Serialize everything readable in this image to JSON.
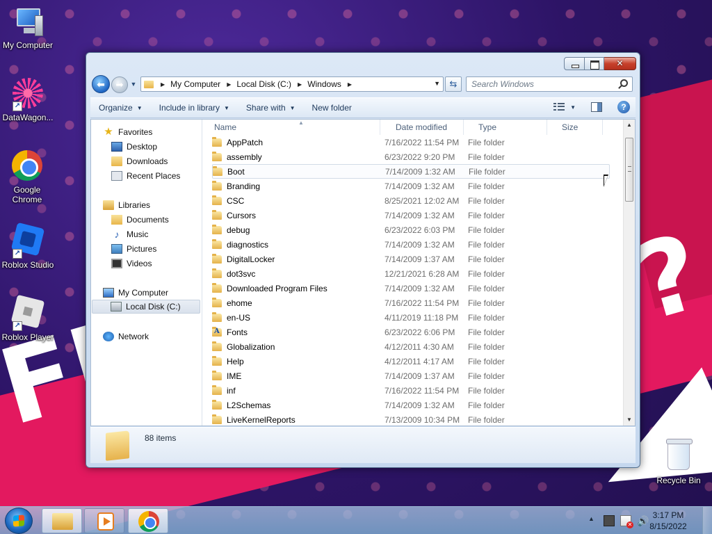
{
  "desktop": {
    "icons": [
      {
        "label": "My Computer"
      },
      {
        "label": "DataWagon..."
      },
      {
        "label": "Google Chrome"
      },
      {
        "label": "Roblox Studio"
      },
      {
        "label": "Roblox Player"
      },
      {
        "label": "Recycle Bin"
      }
    ],
    "wallpaper_text": [
      "FFF",
      "?"
    ]
  },
  "window": {
    "back_arrow": "⬅",
    "forward_arrow": "➡",
    "address": {
      "crumbs": [
        "My Computer",
        "Local Disk (C:)",
        "Windows"
      ]
    },
    "search": {
      "placeholder": "Search Windows"
    },
    "toolbar": {
      "organize": "Organize",
      "include_in_library": "Include in library",
      "share_with": "Share with",
      "new_folder": "New folder"
    },
    "nav": {
      "favorites": "Favorites",
      "desktop": "Desktop",
      "downloads": "Downloads",
      "recent_places": "Recent Places",
      "libraries": "Libraries",
      "documents": "Documents",
      "music": "Music",
      "pictures": "Pictures",
      "videos": "Videos",
      "my_computer": "My Computer",
      "local_disk": "Local Disk (C:)",
      "network": "Network"
    },
    "columns": {
      "name": "Name",
      "date": "Date modified",
      "type": "Type",
      "size": "Size"
    },
    "files": [
      {
        "name": "AppPatch",
        "date": "7/16/2022 11:54 PM",
        "type": "File folder"
      },
      {
        "name": "assembly",
        "date": "6/23/2022 9:20 PM",
        "type": "File folder"
      },
      {
        "name": "Boot",
        "date": "7/14/2009 1:32 AM",
        "type": "File folder"
      },
      {
        "name": "Branding",
        "date": "7/14/2009 1:32 AM",
        "type": "File folder"
      },
      {
        "name": "CSC",
        "date": "8/25/2021 12:02 AM",
        "type": "File folder"
      },
      {
        "name": "Cursors",
        "date": "7/14/2009 1:32 AM",
        "type": "File folder"
      },
      {
        "name": "debug",
        "date": "6/23/2022 6:03 PM",
        "type": "File folder"
      },
      {
        "name": "diagnostics",
        "date": "7/14/2009 1:32 AM",
        "type": "File folder"
      },
      {
        "name": "DigitalLocker",
        "date": "7/14/2009 1:37 AM",
        "type": "File folder"
      },
      {
        "name": "dot3svc",
        "date": "12/21/2021 6:28 AM",
        "type": "File folder"
      },
      {
        "name": "Downloaded Program Files",
        "date": "7/14/2009 1:32 AM",
        "type": "File folder"
      },
      {
        "name": "ehome",
        "date": "7/16/2022 11:54 PM",
        "type": "File folder"
      },
      {
        "name": "en-US",
        "date": "4/11/2019 11:18 PM",
        "type": "File folder"
      },
      {
        "name": "Fonts",
        "date": "6/23/2022 6:06 PM",
        "type": "File folder"
      },
      {
        "name": "Globalization",
        "date": "4/12/2011 4:30 AM",
        "type": "File folder"
      },
      {
        "name": "Help",
        "date": "4/12/2011 4:17 AM",
        "type": "File folder"
      },
      {
        "name": "IME",
        "date": "7/14/2009 1:37 AM",
        "type": "File folder"
      },
      {
        "name": "inf",
        "date": "7/16/2022 11:54 PM",
        "type": "File folder"
      },
      {
        "name": "L2Schemas",
        "date": "7/14/2009 1:32 AM",
        "type": "File folder"
      },
      {
        "name": "LiveKernelReports",
        "date": "7/13/2009 10:34 PM",
        "type": "File folder"
      }
    ],
    "hovered_row": "Boot",
    "details": {
      "items_count": "88 items"
    }
  },
  "taskbar": {
    "clock_time": "3:17 PM",
    "clock_date": "8/15/2022",
    "tray_icons": [
      "network-icon",
      "action-center-flag-icon",
      "volume-icon"
    ]
  }
}
